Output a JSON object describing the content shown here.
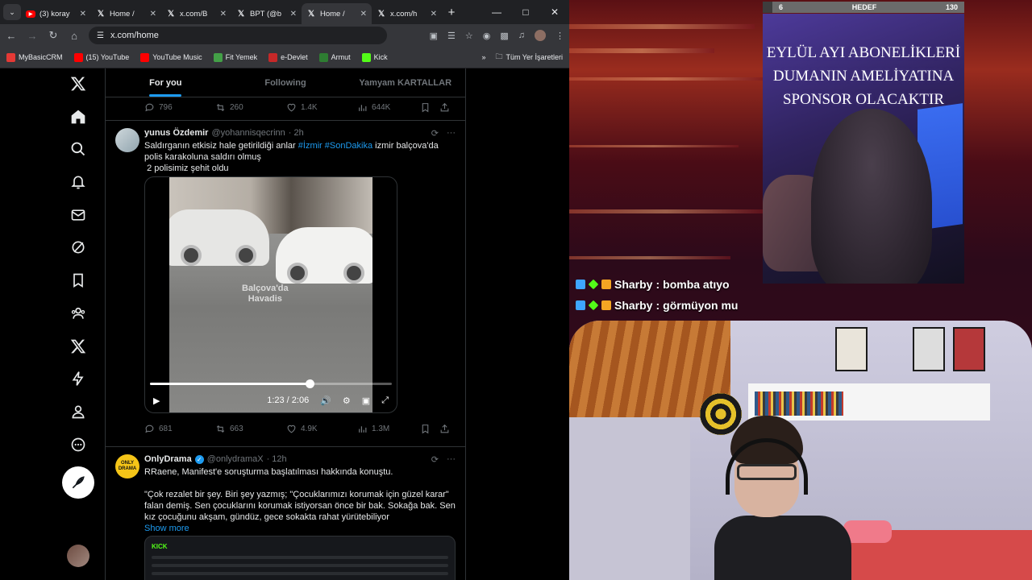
{
  "browser": {
    "tabs": [
      {
        "icon": "youtube-icon",
        "title": "(3) koray",
        "active": false
      },
      {
        "icon": "x-icon",
        "title": "Home /",
        "active": false
      },
      {
        "icon": "x-icon",
        "title": "x.com/B",
        "active": false
      },
      {
        "icon": "x-icon",
        "title": "BPT (@b",
        "active": false
      },
      {
        "icon": "x-icon",
        "title": "Home /",
        "active": true
      },
      {
        "icon": "x-icon",
        "title": "x.com/h",
        "active": false
      }
    ],
    "url": "x.com/home",
    "bookmarks": [
      {
        "label": "MyBasicCRM",
        "color": "#e53935"
      },
      {
        "label": "(15) YouTube",
        "color": "#ff0000"
      },
      {
        "label": "YouTube Music",
        "color": "#ff0000"
      },
      {
        "label": "Fit Yemek",
        "color": "#43a047"
      },
      {
        "label": "e-Devlet",
        "color": "#c62828"
      },
      {
        "label": "Armut",
        "color": "#2e7d32"
      },
      {
        "label": "Kick",
        "color": "#53fc18"
      }
    ],
    "bookmarks_all": "Tüm Yer İşaretleri"
  },
  "feed": {
    "tabs": [
      "For you",
      "Following",
      "Yamyam KARTALLAR"
    ],
    "top_actions": {
      "replies": "796",
      "reposts": "260",
      "likes": "1.4K",
      "views": "644K"
    },
    "tweet1": {
      "name": "yunus Özdemir",
      "handle": "@yohannisqecrinn",
      "time": "· 2h",
      "text_a": "Saldırganın etkisiz hale getirildiği anlar ",
      "hash1": "#İzmir",
      "hash2": "#SonDakika",
      "text_b": " izmir balçova'da polis karakoluna saldırı olmuş",
      "text_c": "2 polisimiz şehit oldu",
      "video_watermark_1": "Balçova'da",
      "video_watermark_2": "Havadis",
      "video_time": "1:23 / 2:06",
      "video_progress": 0.66,
      "actions": {
        "replies": "681",
        "reposts": "663",
        "likes": "4.9K",
        "views": "1.3M"
      }
    },
    "tweet2": {
      "name": "OnlyDrama",
      "handle": "@onlydramaX",
      "time": "· 12h",
      "avatar_text": "ONLY DRAMA",
      "line1": "RRaene, Manifest'e soruşturma başlatılması hakkında konuştu.",
      "line2": "\"Çok rezalet bir şey. Biri şey yazmış; \"Çocuklarımızı korumak için güzel karar\" falan demiş. Sen çocuklarını korumak istiyorsan önce bir bak. Sokağa bak. Sen kız çocuğunu akşam, gündüz, gece sokakta rahat yürütebiliyor",
      "show_more": "Show more",
      "preview_logo": "KICK"
    }
  },
  "stream": {
    "goal_left": "6",
    "goal_label": "HEDEF",
    "goal_right": "130",
    "goal_progress": 0.046,
    "cat_caption_1": "EYLÜL AYI ABONELİKLERİ",
    "cat_caption_2": "DUMANIN AMELİYATINA",
    "cat_caption_3": "SPONSOR OLACAKTIR",
    "chat": [
      {
        "user": "Sharby",
        "message": "bomba atıyo"
      },
      {
        "user": "Sharby",
        "message": "görmüyon mu"
      }
    ]
  }
}
